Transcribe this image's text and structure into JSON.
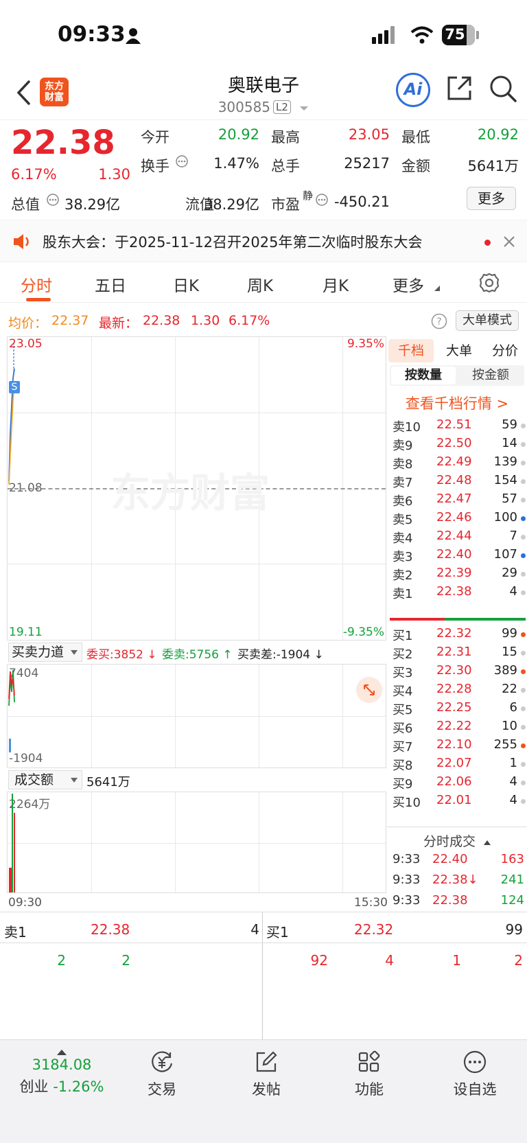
{
  "status_bar": {
    "time": "09:33",
    "battery": "75"
  },
  "nav": {
    "logo_line1": "东方",
    "logo_line2": "财富",
    "stock_name": "奥联电子",
    "stock_code": "300585",
    "level_badge": "L2",
    "ai_label": "Ai"
  },
  "quote": {
    "price": "22.38",
    "change_pct": "6.17%",
    "change": "1.30",
    "open_label": "今开",
    "open": "20.92",
    "high_label": "最高",
    "high": "23.05",
    "low_label": "最低",
    "low": "20.92",
    "turnover_label": "换手",
    "turnover": "1.47%",
    "volume_label": "总手",
    "volume": "25217",
    "amount_label": "金额",
    "amount": "5641万",
    "mktcap_label": "总值",
    "mktcap": "38.29亿",
    "float_label": "流值",
    "float": "38.29亿",
    "pe_label": "市盈",
    "pe_sup": "静",
    "pe": "-450.21",
    "more_label": "更多"
  },
  "notice": {
    "text": "股东大会：于2025-11-12召开2025年第二次临时股东大会"
  },
  "tabs": [
    "分时",
    "五日",
    "日K",
    "周K",
    "月K",
    "更多"
  ],
  "avg_row": {
    "avg_label": "均价：",
    "avg": "22.37",
    "latest_label": "最新：",
    "latest": "22.38",
    "change": "1.30",
    "change_pct": "6.17%",
    "big_mode": "大单模式"
  },
  "chart": {
    "y_top": "23.05",
    "y_mid": "21.08",
    "y_bot": "19.11",
    "pct_top": "9.35%",
    "pct_bot": "-9.35%",
    "watermark": "东方财富",
    "marker": "S",
    "t_start": "09:30",
    "t_end": "15:30"
  },
  "force_panel": {
    "selector": "买卖力道",
    "bid_label": "委买:3852",
    "ask_label": "委卖:5756",
    "diff_label": "买卖差:-1904",
    "y_top": "7404",
    "y_bot": "-1904"
  },
  "amount_panel": {
    "selector": "成交额",
    "value": "5641万",
    "y_top": "2264万"
  },
  "order_book": {
    "tab_thousand": "千档",
    "tab_big": "大单",
    "tab_price": "分价",
    "by_volume": "按数量",
    "by_amount": "按金额",
    "view_link": "查看千档行情 >",
    "asks": [
      {
        "label": "卖10",
        "price": "22.51",
        "vol": "59",
        "dot": "#cccccc"
      },
      {
        "label": "卖9",
        "price": "22.50",
        "vol": "14",
        "dot": "#cccccc"
      },
      {
        "label": "卖8",
        "price": "22.49",
        "vol": "139",
        "dot": "#cccccc"
      },
      {
        "label": "卖7",
        "price": "22.48",
        "vol": "154",
        "dot": "#cccccc"
      },
      {
        "label": "卖6",
        "price": "22.47",
        "vol": "57",
        "dot": "#cccccc"
      },
      {
        "label": "卖5",
        "price": "22.46",
        "vol": "100",
        "dot": "#2f6fd6"
      },
      {
        "label": "卖4",
        "price": "22.44",
        "vol": "7",
        "dot": "#cccccc"
      },
      {
        "label": "卖3",
        "price": "22.40",
        "vol": "107",
        "dot": "#2f6fd6"
      },
      {
        "label": "卖2",
        "price": "22.39",
        "vol": "29",
        "dot": "#cccccc"
      },
      {
        "label": "卖1",
        "price": "22.38",
        "vol": "4",
        "dot": "#cccccc"
      }
    ],
    "bids": [
      {
        "label": "买1",
        "price": "22.32",
        "vol": "99",
        "dot": "#f0541e"
      },
      {
        "label": "买2",
        "price": "22.31",
        "vol": "15",
        "dot": "#cccccc"
      },
      {
        "label": "买3",
        "price": "22.30",
        "vol": "389",
        "dot": "#f0541e"
      },
      {
        "label": "买4",
        "price": "22.28",
        "vol": "22",
        "dot": "#cccccc"
      },
      {
        "label": "买5",
        "price": "22.25",
        "vol": "6",
        "dot": "#cccccc"
      },
      {
        "label": "买6",
        "price": "22.22",
        "vol": "10",
        "dot": "#cccccc"
      },
      {
        "label": "买7",
        "price": "22.10",
        "vol": "255",
        "dot": "#f0541e"
      },
      {
        "label": "买8",
        "price": "22.07",
        "vol": "1",
        "dot": "#cccccc"
      },
      {
        "label": "买9",
        "price": "22.06",
        "vol": "4",
        "dot": "#cccccc"
      },
      {
        "label": "买10",
        "price": "22.01",
        "vol": "4",
        "dot": "#cccccc"
      }
    ],
    "ticks_header": "分时成交",
    "ticks": [
      {
        "time": "9:33",
        "price": "22.40",
        "vol": "163",
        "vol_color": "#e6262e"
      },
      {
        "time": "9:33",
        "price": "22.38↓",
        "vol": "241",
        "vol_color": "#15a03a"
      },
      {
        "time": "9:33",
        "price": "22.38",
        "vol": "124",
        "vol_color": "#15a03a"
      }
    ]
  },
  "levels": {
    "ask_label": "卖1",
    "ask_price": "22.38",
    "ask_vol": "4",
    "bid_label": "买1",
    "bid_price": "22.32",
    "bid_vol": "99",
    "ask_queue": [
      "2",
      "2"
    ],
    "bid_queue": [
      "92",
      "4",
      "1",
      "2"
    ]
  },
  "bottom_bar": {
    "index_value": "3184.08",
    "index_name": "创业",
    "index_change": "-1.26%",
    "trade": "交易",
    "post": "发帖",
    "features": "功能",
    "watchlist": "设自选"
  }
}
